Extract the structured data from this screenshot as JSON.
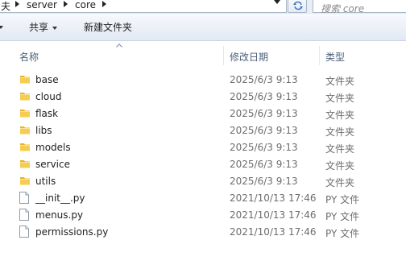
{
  "address_bar": {
    "crumbs": [
      "夫",
      "server",
      "core"
    ]
  },
  "search": {
    "placeholder": "搜索 core"
  },
  "toolbar": {
    "share_label": "共享",
    "new_folder_label": "新建文件夹"
  },
  "columns": {
    "name": "名称",
    "modified": "修改日期",
    "type": "类型"
  },
  "files": [
    {
      "name": "base",
      "modified": "2025/6/3 9:13",
      "type": "文件夹",
      "icon": "folder-icon"
    },
    {
      "name": "cloud",
      "modified": "2025/6/3 9:13",
      "type": "文件夹",
      "icon": "folder-icon"
    },
    {
      "name": "flask",
      "modified": "2025/6/3 9:13",
      "type": "文件夹",
      "icon": "folder-icon"
    },
    {
      "name": "libs",
      "modified": "2025/6/3 9:13",
      "type": "文件夹",
      "icon": "folder-icon"
    },
    {
      "name": "models",
      "modified": "2025/6/3 9:13",
      "type": "文件夹",
      "icon": "folder-icon"
    },
    {
      "name": "service",
      "modified": "2025/6/3 9:13",
      "type": "文件夹",
      "icon": "folder-icon"
    },
    {
      "name": "utils",
      "modified": "2025/6/3 9:13",
      "type": "文件夹",
      "icon": "folder-icon"
    },
    {
      "name": "__init__.py",
      "modified": "2021/10/13 17:46",
      "type": "PY 文件",
      "icon": "file-icon"
    },
    {
      "name": "menus.py",
      "modified": "2021/10/13 17:46",
      "type": "PY 文件",
      "icon": "file-icon"
    },
    {
      "name": "permissions.py",
      "modified": "2021/10/13 17:46",
      "type": "PY 文件",
      "icon": "file-icon"
    }
  ],
  "colors": {
    "folder": "#f2c641",
    "toolbar_bg": "#e9eef6",
    "header_text": "#4c607a",
    "secondary_text": "#6d6d6d"
  }
}
